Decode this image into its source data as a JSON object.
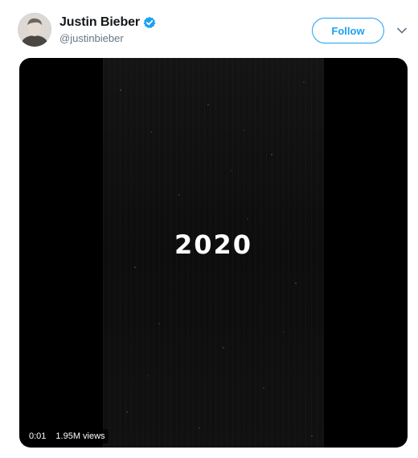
{
  "tweet": {
    "author": {
      "display_name": "Justin Bieber",
      "handle": "@justinbieber",
      "verified_icon": "verified-check-icon"
    },
    "follow_label": "Follow",
    "menu_icon": "chevron-down-icon"
  },
  "media": {
    "overlay_text": "2020",
    "timestamp": "0:01",
    "views": "1.95M views"
  },
  "colors": {
    "accent": "#1da1f2",
    "text_primary": "#14171a",
    "text_secondary": "#657786",
    "media_background": "#000000"
  }
}
